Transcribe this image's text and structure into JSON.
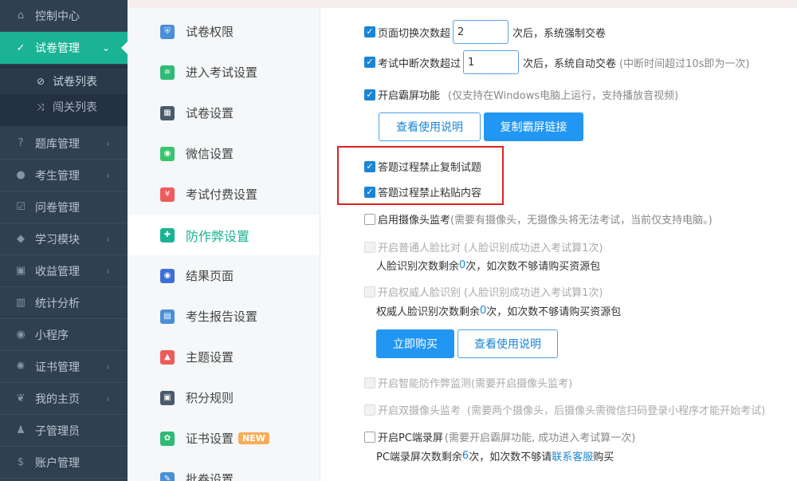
{
  "leftnav": {
    "items": [
      {
        "label": "控制中心",
        "icon": "home-icon",
        "glyph": "⌂",
        "arrow": ""
      },
      {
        "label": "试卷管理",
        "icon": "check-circle-icon",
        "glyph": "✓",
        "arrow": "⌄"
      },
      {
        "label": "题库管理",
        "icon": "question-circle-icon",
        "glyph": "?",
        "arrow": "‹"
      },
      {
        "label": "考生管理",
        "icon": "user-icon",
        "glyph": "●",
        "arrow": "‹"
      },
      {
        "label": "问卷管理",
        "icon": "checkbox-icon",
        "glyph": "☑",
        "arrow": ""
      },
      {
        "label": "学习模块",
        "icon": "graduation-cap-icon",
        "glyph": "◆",
        "arrow": "‹"
      },
      {
        "label": "收益管理",
        "icon": "money-icon",
        "glyph": "▣",
        "arrow": "‹"
      },
      {
        "label": "统计分析",
        "icon": "bar-chart-icon",
        "glyph": "▥",
        "arrow": ""
      },
      {
        "label": "小程序",
        "icon": "wechat-icon",
        "glyph": "◉",
        "arrow": ""
      },
      {
        "label": "证书管理",
        "icon": "gear-icon",
        "glyph": "✺",
        "arrow": "‹"
      },
      {
        "label": "我的主页",
        "icon": "leaf-icon",
        "glyph": "❦",
        "arrow": "‹"
      },
      {
        "label": "子管理员",
        "icon": "user-tie-icon",
        "glyph": "♟",
        "arrow": ""
      },
      {
        "label": "账户管理",
        "icon": "dollar-icon",
        "glyph": "$",
        "arrow": ""
      }
    ],
    "sub_items": [
      {
        "label": "试卷列表",
        "icon": "check-circle-icon",
        "glyph": "⊘"
      },
      {
        "label": "闯关列表",
        "icon": "shuffle-icon",
        "glyph": "⤨"
      }
    ]
  },
  "midmenu": {
    "items": [
      {
        "label": "试卷权限",
        "icon": "shield-icon",
        "color": "#4a8fd8"
      },
      {
        "label": "进入考试设置",
        "icon": "document-icon",
        "color": "#2fbb77"
      },
      {
        "label": "试卷设置",
        "icon": "calculator-icon",
        "color": "#4b5a6b"
      },
      {
        "label": "微信设置",
        "icon": "wechat-icon",
        "color": "#37c46a"
      },
      {
        "label": "考试付费设置",
        "icon": "yen-icon",
        "color": "#ef5b5b"
      },
      {
        "label": "防作弊设置",
        "icon": "shield-plus-icon",
        "color": "#1ab394"
      },
      {
        "label": "结果页面",
        "icon": "eye-icon",
        "color": "#3d6fd8"
      },
      {
        "label": "考生报告设置",
        "icon": "report-icon",
        "color": "#4a8fd8"
      },
      {
        "label": "主题设置",
        "icon": "shirt-icon",
        "color": "#ef5b5b"
      },
      {
        "label": "积分规则",
        "icon": "gift-icon",
        "color": "#4b5a6b"
      },
      {
        "label": "证书设置",
        "icon": "certificate-icon",
        "color": "#2fbb77",
        "badge": "NEW"
      },
      {
        "label": "批卷设置",
        "icon": "edit-icon",
        "color": "#4a8fd8"
      }
    ]
  },
  "settings": {
    "page_switch": {
      "prefix": "页面切换次数超",
      "value": "2",
      "suffix": "次后，系统强制交卷"
    },
    "interrupt": {
      "prefix": "考试中断次数超过",
      "value": "1",
      "suffix": "次后，系统自动交卷",
      "note": "(中断时间超过10s即为一次)"
    },
    "lock_screen": {
      "label": "开启霸屏功能",
      "note": "(仅支持在Windows电脑上运行，支持播放音视频)"
    },
    "lock_screen_buttons": {
      "guide": "查看使用说明",
      "copy_link": "复制霸屏链接"
    },
    "no_copy": "答题过程禁止复制试题",
    "no_paste": "答题过程禁止粘贴内容",
    "camera": {
      "label": "启用摄像头监考",
      "note": "(需要有摄像头，无摄像头将无法考试，当前仅支持电脑。)"
    },
    "face_compare": {
      "label": "开启普通人脸比对",
      "note": "(人脸识别成功进入考试算1次)",
      "remain_prefix": "人脸识别次数剩余",
      "remain_count": "0",
      "remain_suffix": "次，如次数不够请购买资源包"
    },
    "face_auth": {
      "label": "开启权威人脸识别",
      "note": "(人脸识别成功进入考试算1次)",
      "remain_prefix": "权威人脸识别次数剩余",
      "remain_count": "0",
      "remain_suffix": "次，如次数不够请购买资源包"
    },
    "face_buttons": {
      "buy": "立即购买",
      "guide": "查看使用说明"
    },
    "smart_anticheat": {
      "label": "开启智能防作弊监测",
      "note": "(需要开启摄像头监考)"
    },
    "dual_camera": {
      "label": "开启双摄像头监考",
      "note": "(需要两个摄像头，后摄像头需微信扫码登录小程序才能开始考试)"
    },
    "pc_record": {
      "label": "开启PC端录屏",
      "note": "(需要开启霸屏功能, 成功进入考试算一次)",
      "remain_prefix": "PC端录屏次数剩余",
      "remain_count": "6",
      "remain_mid": "次，如次数不够请",
      "link": "联系客服",
      "remain_suffix": "购买"
    }
  },
  "colors": {
    "accent": "#1ab394",
    "primary": "#2196f3",
    "highlight_box": "#e02020",
    "sidebar_bg": "#2f4050"
  }
}
